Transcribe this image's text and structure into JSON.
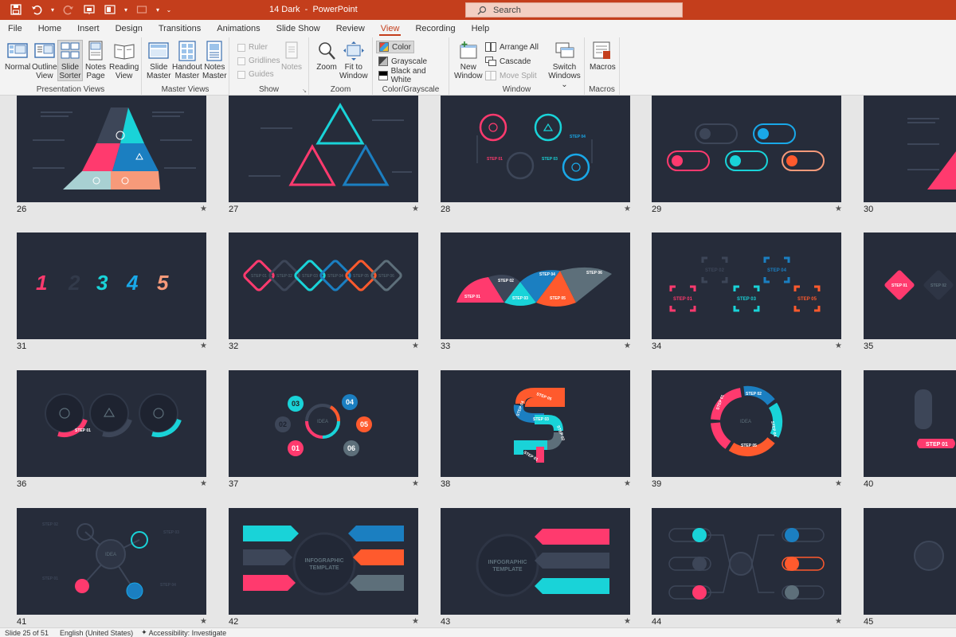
{
  "app": {
    "document_name": "14 Dark",
    "separator": "-",
    "app_name": "PowerPoint",
    "accent": "#c43e1c"
  },
  "search": {
    "placeholder": "Search"
  },
  "tabs": [
    {
      "label": "File"
    },
    {
      "label": "Home"
    },
    {
      "label": "Insert"
    },
    {
      "label": "Design"
    },
    {
      "label": "Transitions"
    },
    {
      "label": "Animations"
    },
    {
      "label": "Slide Show"
    },
    {
      "label": "Review"
    },
    {
      "label": "View",
      "active": true
    },
    {
      "label": "Recording"
    },
    {
      "label": "Help"
    }
  ],
  "ribbon": {
    "presentation_views": {
      "label": "Presentation Views",
      "normal": "Normal",
      "outline_1": "Outline",
      "outline_2": "View",
      "sorter_1": "Slide",
      "sorter_2": "Sorter",
      "notes_1": "Notes",
      "notes_2": "Page",
      "reading_1": "Reading",
      "reading_2": "View"
    },
    "master_views": {
      "label": "Master Views",
      "slide_1": "Slide",
      "slide_2": "Master",
      "handout_1": "Handout",
      "handout_2": "Master",
      "notes_1": "Notes",
      "notes_2": "Master"
    },
    "show": {
      "label": "Show",
      "ruler": "Ruler",
      "gridlines": "Gridlines",
      "guides": "Guides",
      "notes": "Notes"
    },
    "zoom": {
      "label": "Zoom",
      "zoom": "Zoom",
      "fit_1": "Fit to",
      "fit_2": "Window"
    },
    "color": {
      "label": "Color/Grayscale",
      "color": "Color",
      "grayscale": "Grayscale",
      "bw": "Black and White"
    },
    "window": {
      "label": "Window",
      "new_1": "New",
      "new_2": "Window",
      "arrange": "Arrange All",
      "cascade": "Cascade",
      "move_split": "Move Split",
      "switch_1": "Switch",
      "switch_2": "Windows ⌄"
    },
    "macros": {
      "label": "Macros",
      "macros": "Macros"
    }
  },
  "slides": [
    {
      "number": "26",
      "star": "★"
    },
    {
      "number": "27",
      "star": "★"
    },
    {
      "number": "28",
      "star": "★"
    },
    {
      "number": "29",
      "star": "★"
    },
    {
      "number": "30",
      "star": ""
    },
    {
      "number": "31",
      "star": "★"
    },
    {
      "number": "32",
      "star": "★"
    },
    {
      "number": "33",
      "star": "★"
    },
    {
      "number": "34",
      "star": "★"
    },
    {
      "number": "35",
      "star": ""
    },
    {
      "number": "36",
      "star": "★"
    },
    {
      "number": "37",
      "star": "★"
    },
    {
      "number": "38",
      "star": "★"
    },
    {
      "number": "39",
      "star": "★"
    },
    {
      "number": "40",
      "star": ""
    },
    {
      "number": "41",
      "star": "★"
    },
    {
      "number": "42",
      "star": "★"
    },
    {
      "number": "43",
      "star": "★"
    },
    {
      "number": "44",
      "star": "★"
    },
    {
      "number": "45",
      "star": ""
    }
  ],
  "slide_text": {
    "s28": {
      "step01": "STEP 01",
      "step03": "STEP 03",
      "step04": "STEP 04"
    },
    "s31": {
      "n1": "1",
      "n3": "3",
      "n4": "4",
      "n5": "5"
    },
    "s32": {
      "a": "STEP 01",
      "b": "STEP 02",
      "c": "STEP 03",
      "d": "STEP 04",
      "e": "STEP 05",
      "f": "STEP 06"
    },
    "s33": {
      "a": "STEP 01",
      "b": "STEP 02",
      "c": "STEP 03",
      "d": "STEP 04",
      "e": "STEP 05",
      "f": "STEP 06"
    },
    "s34": {
      "a": "STEP 01",
      "b": "STEP 02",
      "c": "STEP 03",
      "d": "STEP 04",
      "e": "STEP 05"
    },
    "s35": {
      "a": "STEP 01",
      "b": "STEP 02"
    },
    "s36": {
      "a": "STEP 01"
    },
    "s37": {
      "n01": "01",
      "n02": "02",
      "n03": "03",
      "n04": "04",
      "n05": "05",
      "n06": "06",
      "idea": "IDEA"
    },
    "s38": {
      "a": "STEP 01",
      "b": "STEP 02",
      "c": "STEP 03",
      "d": "STEP 04",
      "e": "STEP 05"
    },
    "s39": {
      "idea": "IDEA",
      "a": "STEP 01",
      "b": "STEP 02",
      "c": "STEP 03",
      "d": "STEP 04",
      "e": "STEP 05"
    },
    "s40": {
      "a": "STEP 01"
    },
    "s41": {
      "a": "STEP 02",
      "b": "STEP 03",
      "c": "STEP 01",
      "d": "STEP 04",
      "idea": "IDEA"
    },
    "s42": {
      "t1": "INFOGRAPHIC",
      "t2": "TEMPLATE"
    },
    "s43": {
      "t1": "INFOGRAPHIC",
      "t2": "TEMPLATE"
    }
  },
  "status": {
    "slide_info": "Slide 25 of 51",
    "language": "English (United States)",
    "accessibility": "Accessibility: Investigate"
  },
  "colors": {
    "slide_bg": "#262c3a",
    "pink": "#ff3a6e",
    "cyan": "#19d3d8",
    "blue": "#1b7fc1",
    "orange": "#ff5a2d",
    "slate": "#5d6f7a",
    "peach": "#f79a7a"
  }
}
